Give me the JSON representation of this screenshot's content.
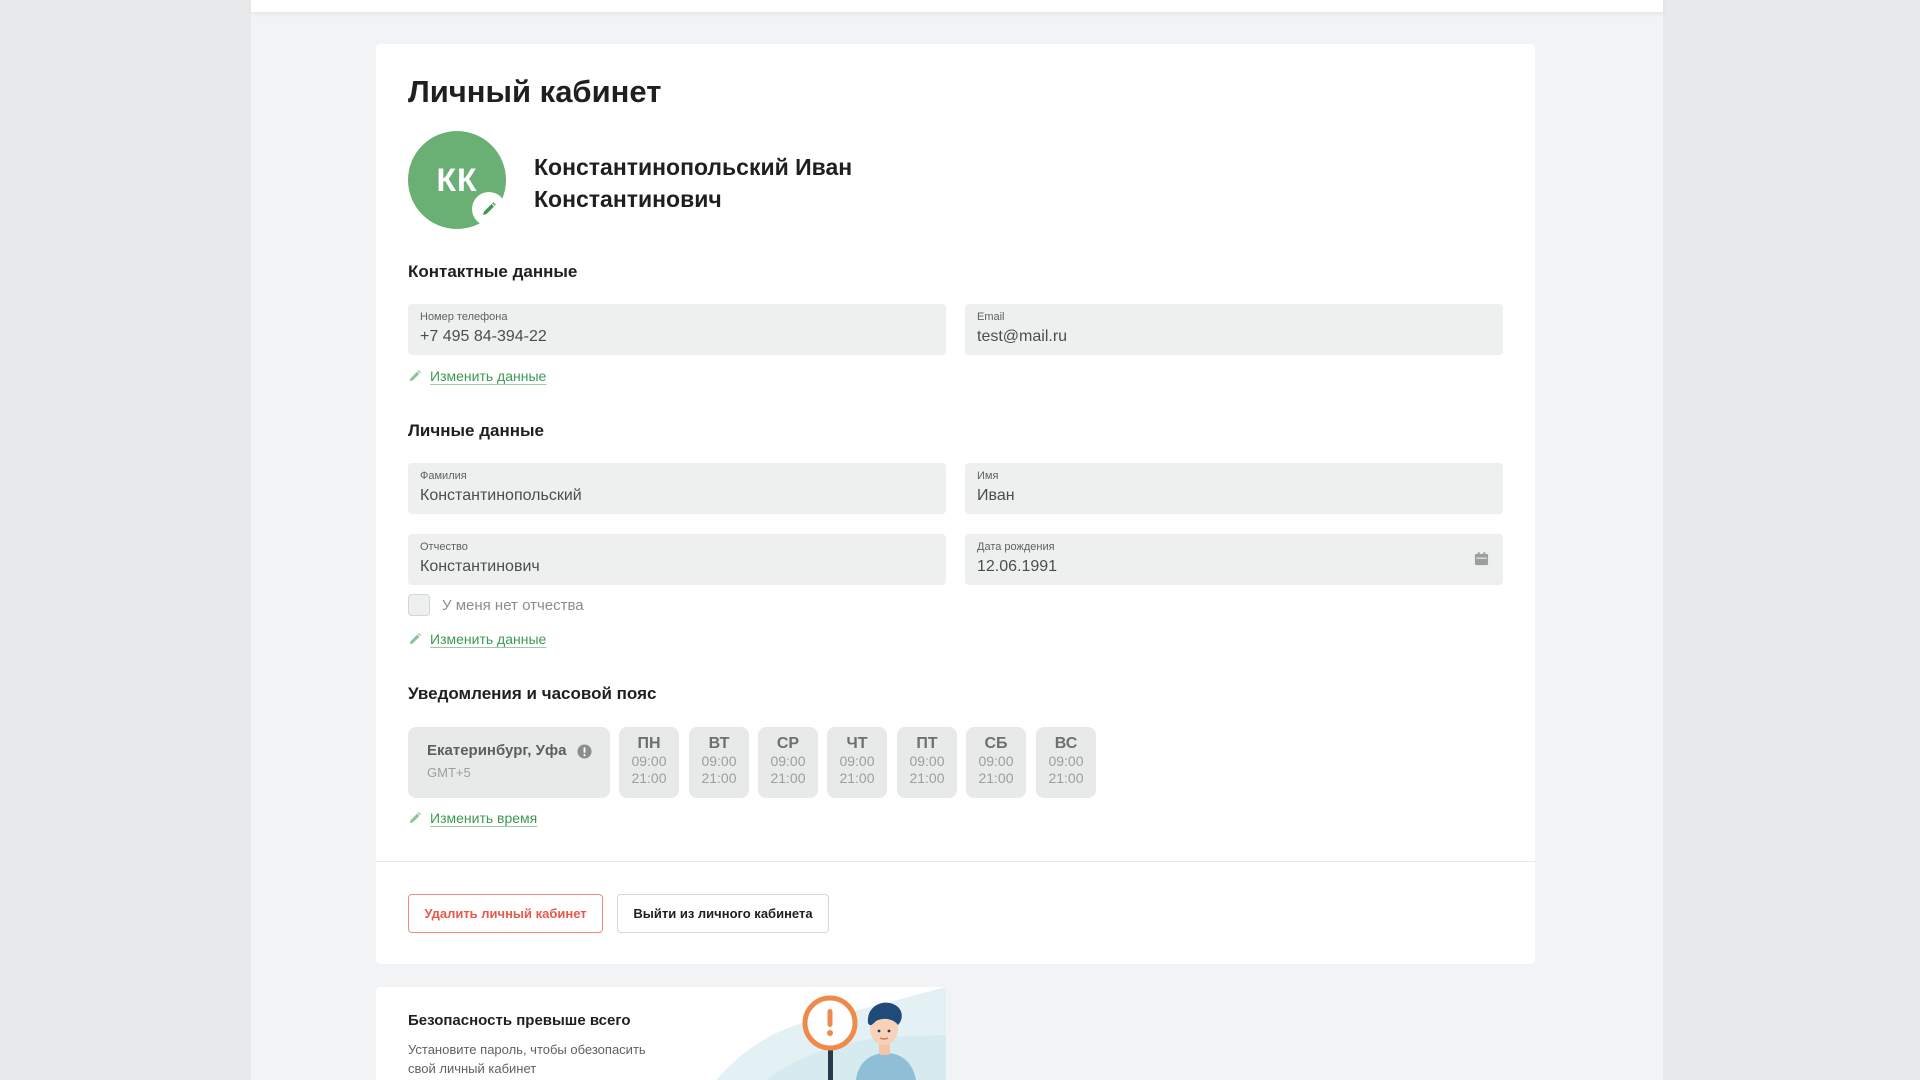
{
  "page": {
    "title": "Личный кабинет"
  },
  "profile": {
    "initials": "КК",
    "name_line1": "Константинопольский Иван",
    "name_line2": "Константинович"
  },
  "contacts": {
    "title": "Контактные данные",
    "phone_label": "Номер телефона",
    "phone_value": "+7 495 84-394-22",
    "email_label": "Email",
    "email_value": "test@mail.ru",
    "edit_label": "Изменить данные"
  },
  "personal": {
    "title": "Личные данные",
    "surname_label": "Фамилия",
    "surname_value": "Константинопольский",
    "firstname_label": "Имя",
    "firstname_value": "Иван",
    "patronymic_label": "Отчество",
    "patronymic_value": "Константинович",
    "birthdate_label": "Дата рождения",
    "birthdate_value": "12.06.1991",
    "no_patronymic_label": "У меня нет отчества",
    "edit_label": "Изменить данные"
  },
  "notifications": {
    "title": "Уведомления и часовой пояс",
    "timezone_city": "Екатеринбург, Уфа",
    "timezone_gmt": "GMT+5",
    "days": [
      {
        "name": "ПН",
        "from": "09:00",
        "to": "21:00"
      },
      {
        "name": "ВТ",
        "from": "09:00",
        "to": "21:00"
      },
      {
        "name": "СР",
        "from": "09:00",
        "to": "21:00"
      },
      {
        "name": "ЧТ",
        "from": "09:00",
        "to": "21:00"
      },
      {
        "name": "ПТ",
        "from": "09:00",
        "to": "21:00"
      },
      {
        "name": "СБ",
        "from": "09:00",
        "to": "21:00"
      },
      {
        "name": "ВС",
        "from": "09:00",
        "to": "21:00"
      }
    ],
    "edit_label": "Изменить время"
  },
  "actions": {
    "delete_label": "Удалить личный кабинет",
    "logout_label": "Выйти из личного кабинета"
  },
  "promo": {
    "title": "Безопасность превыше всего",
    "text": "Установите пароль, чтобы обезопасить свой личный кабинет"
  },
  "colors": {
    "accent_green": "#3d9a52",
    "avatar_green": "#6aaf74",
    "danger_red": "#e8594b",
    "promo_orange": "#f08a4b"
  }
}
